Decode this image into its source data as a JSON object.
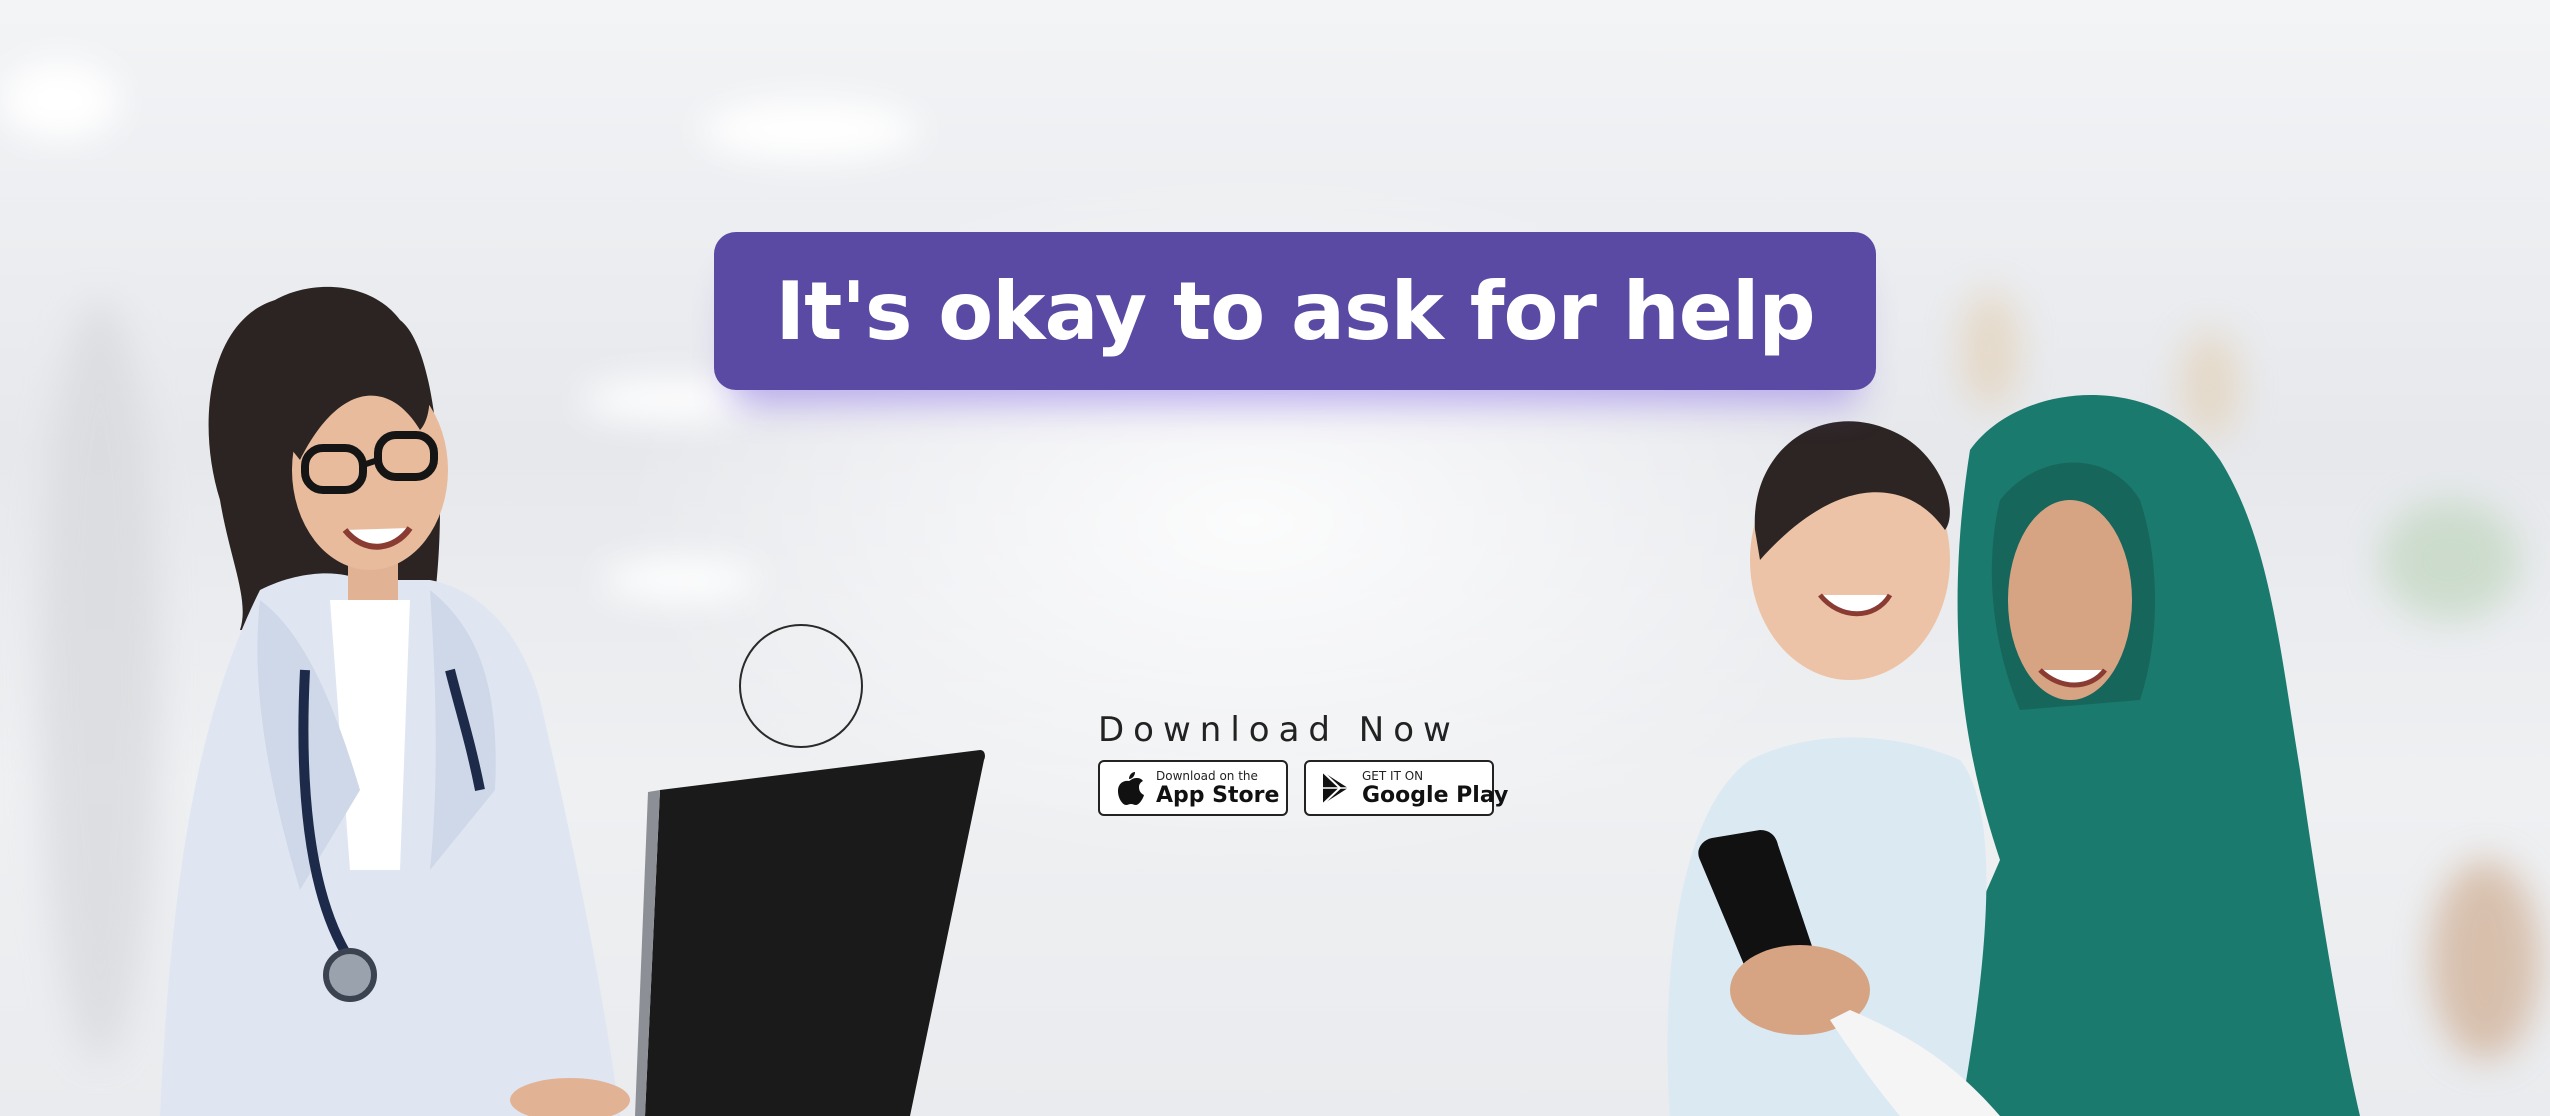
{
  "banner": {
    "headline": "It's okay to ask for help",
    "download_label": "Download Now"
  },
  "stores": {
    "app_store": {
      "small": "Download on the",
      "big": "App Store"
    },
    "google_play": {
      "small": "GET IT ON",
      "big": "Google Play"
    }
  },
  "colors": {
    "headline_bg": "#5a4aa3",
    "hijab": "#1b7a6e"
  },
  "icons": [
    "apple-icon",
    "google-play-icon"
  ]
}
